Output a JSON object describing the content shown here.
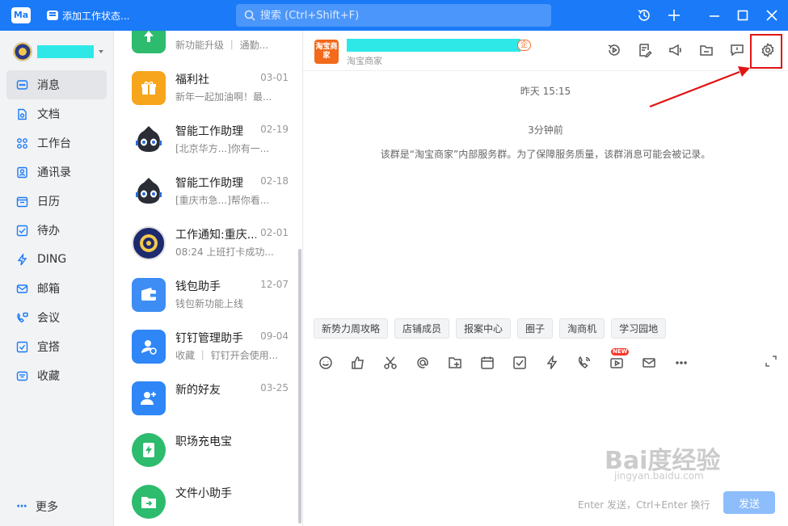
{
  "titlebar": {
    "logo": "Ma",
    "status_label": "添加工作状态...",
    "search_placeholder": "搜索 (Ctrl+Shift+F)"
  },
  "nav": {
    "items": [
      {
        "label": "消息",
        "icon": "message-icon",
        "active": true
      },
      {
        "label": "文档",
        "icon": "document-icon"
      },
      {
        "label": "工作台",
        "icon": "workbench-icon"
      },
      {
        "label": "通讯录",
        "icon": "contacts-icon"
      },
      {
        "label": "日历",
        "icon": "calendar-icon"
      },
      {
        "label": "待办",
        "icon": "todo-icon"
      },
      {
        "label": "DING",
        "icon": "ding-icon"
      },
      {
        "label": "邮箱",
        "icon": "mail-icon"
      },
      {
        "label": "会议",
        "icon": "meeting-icon"
      },
      {
        "label": "宜搭",
        "icon": "yida-icon"
      },
      {
        "label": "收藏",
        "icon": "favorites-icon"
      }
    ],
    "more_label": "更多"
  },
  "conversations": [
    {
      "title": "",
      "date": "",
      "preview": "新功能升级 ｜ 通勤...",
      "icon": "upgrade-icon",
      "color": "#2dbb6e"
    },
    {
      "title": "福利社",
      "date": "03-01",
      "preview": "新年一起加油啊！最...",
      "icon": "gift-icon",
      "color": "#f7a51c"
    },
    {
      "title": "智能工作助理",
      "date": "02-19",
      "preview": "[北京华方...]你有一...",
      "icon": "robot-icon",
      "color": "#2a2d35"
    },
    {
      "title": "智能工作助理",
      "date": "02-18",
      "preview": "[重庆市急...]帮你看...",
      "icon": "robot-icon",
      "color": "#2a2d35"
    },
    {
      "title": "工作通知:重庆...",
      "date": "02-01",
      "preview": "08:24 上班打卡成功...",
      "icon": "school-emblem-icon",
      "color": "#1e2a6e"
    },
    {
      "title": "钱包助手",
      "date": "12-07",
      "preview": "钱包新功能上线",
      "icon": "wallet-icon",
      "color": "#3d8df5"
    },
    {
      "title": "钉钉管理助手",
      "date": "09-04",
      "preview": "收藏 ｜ 钉钉开会使用...",
      "icon": "admin-icon",
      "color": "#2f86f6"
    },
    {
      "title": "新的好友",
      "date": "03-25",
      "preview": "",
      "icon": "add-friend-icon",
      "color": "#2f86f6"
    },
    {
      "title": "职场充电宝",
      "date": "",
      "preview": "",
      "icon": "power-bank-icon",
      "color": "#2dbb6e"
    },
    {
      "title": "文件小助手",
      "date": "",
      "preview": "",
      "icon": "file-helper-icon",
      "color": "#2dbb6e"
    }
  ],
  "chat": {
    "group_avatar_text": "淘宝商家",
    "group_tag": "企",
    "group_subtitle": "淘宝商家",
    "time1": "昨天 15:15",
    "time2": "3分钟前",
    "system_message": "该群是“淘宝商家”内部服务群。为了保障服务质量，该群消息可能会被记录。",
    "quick_actions": [
      "新势力周攻略",
      "店铺成员",
      "报案中心",
      "圈子",
      "淘商机",
      "学习园地"
    ],
    "new_badge": "NEW",
    "send_hint": "Enter 发送，Ctrl+Enter 换行",
    "send_label": "发送"
  },
  "watermark": {
    "text": "Bai度经验",
    "sub": "jingyan.baidu.com"
  },
  "colors": {
    "accent": "#1a7af8",
    "highlight": "#e01515",
    "mask": "#2ee8e8"
  }
}
